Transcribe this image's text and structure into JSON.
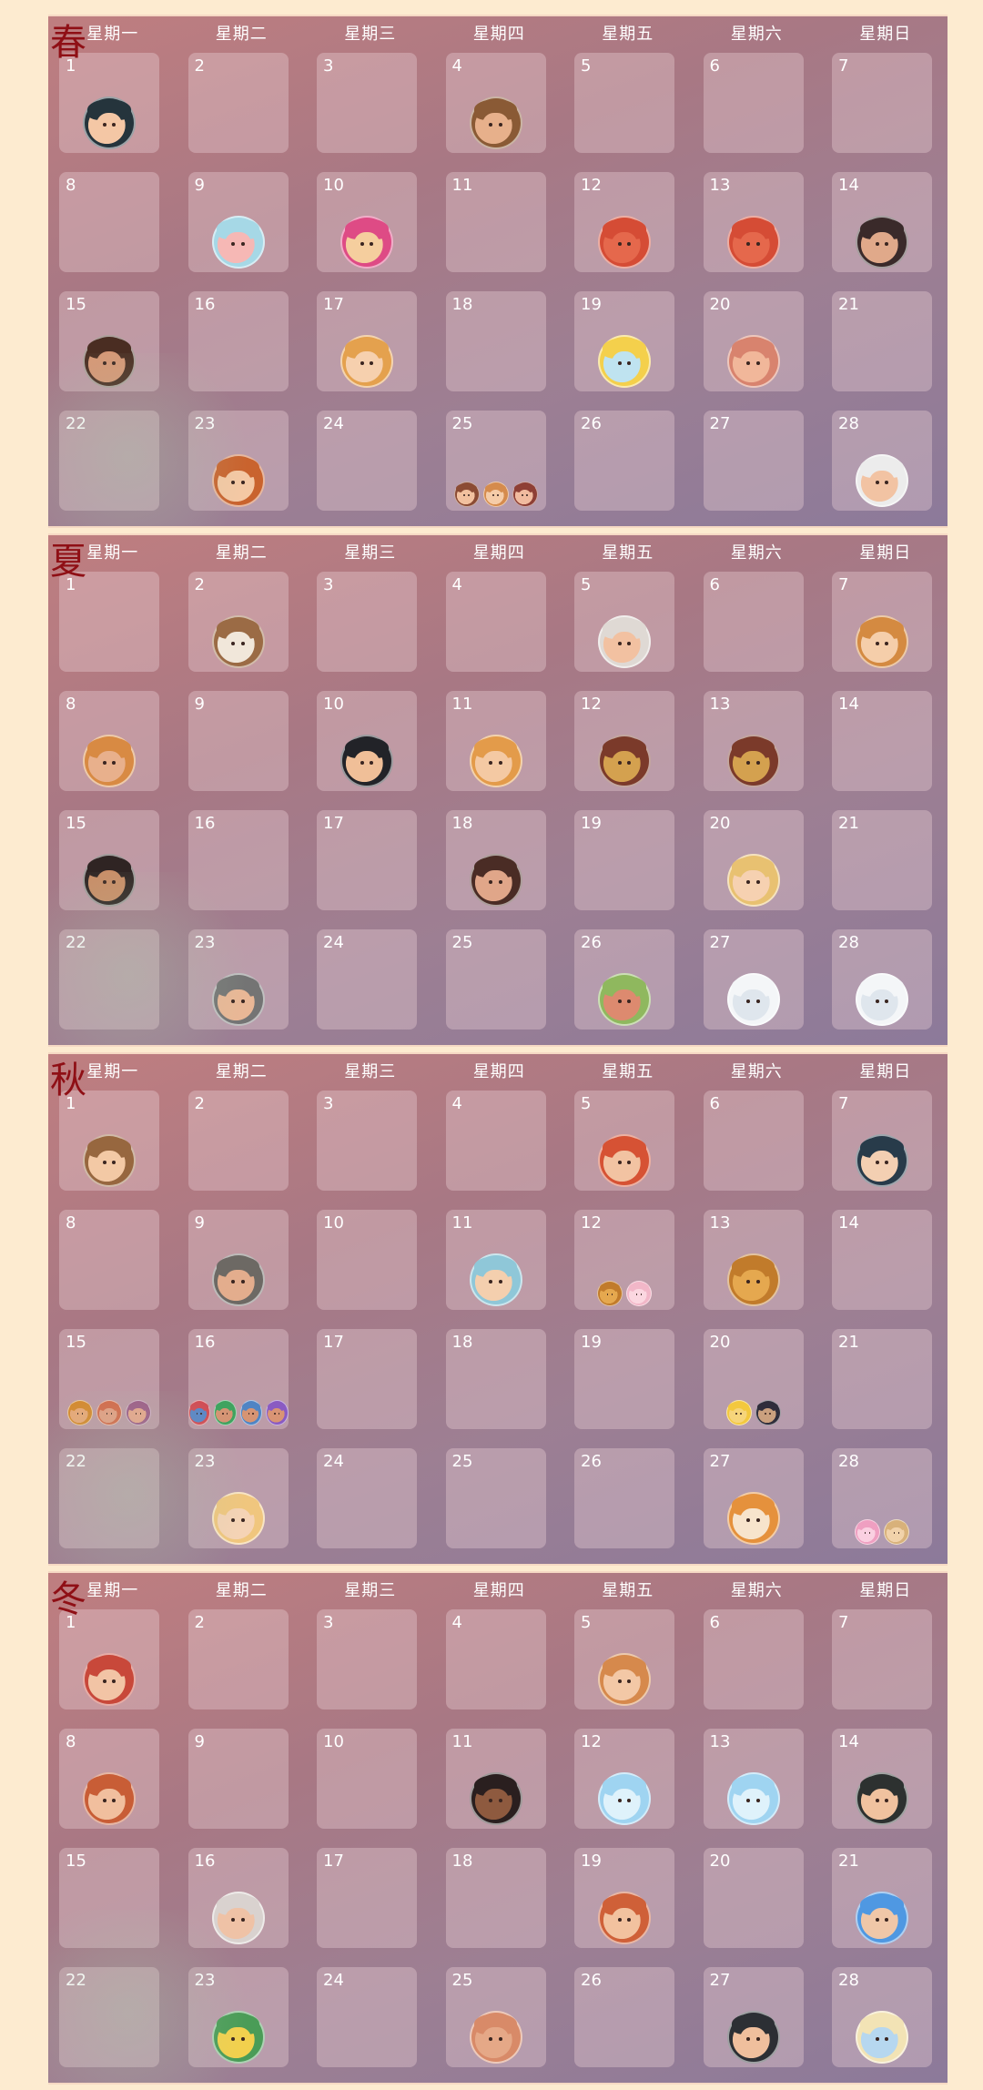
{
  "weekday_labels": [
    "星期一",
    "星期二",
    "星期三",
    "星期四",
    "星期五",
    "星期六",
    "星期日"
  ],
  "seasons": [
    {
      "id": "spring",
      "label": "春",
      "days": [
        {
          "day": "1",
          "icons": [
            {
              "name": "dark-hair-boy-portrait-icon",
              "hair": "#25343c",
              "skin": "#f4c7a5"
            }
          ]
        },
        {
          "day": "2",
          "icons": []
        },
        {
          "day": "3",
          "icons": []
        },
        {
          "day": "4",
          "icons": [
            {
              "name": "bearded-man-portrait-icon",
              "hair": "#8a5a35",
              "skin": "#e7b08b"
            }
          ]
        },
        {
          "day": "5",
          "icons": []
        },
        {
          "day": "6",
          "icons": []
        },
        {
          "day": "7",
          "icons": []
        },
        {
          "day": "8",
          "icons": []
        },
        {
          "day": "9",
          "icons": [
            {
              "name": "pig-head-icon",
              "hair": "#a6d8e6",
              "skin": "#f6b8b5"
            }
          ]
        },
        {
          "day": "10",
          "icons": [
            {
              "name": "pink-hair-boy-portrait-icon",
              "hair": "#de4b85",
              "skin": "#f5ce9e"
            }
          ]
        },
        {
          "day": "11",
          "icons": []
        },
        {
          "day": "12",
          "icons": [
            {
              "name": "red-fish-icon",
              "hair": "#d54c35",
              "skin": "#e5684c"
            }
          ]
        },
        {
          "day": "13",
          "icons": [
            {
              "name": "red-fish-icon",
              "hair": "#d54c35",
              "skin": "#e5684c"
            }
          ]
        },
        {
          "day": "14",
          "icons": [
            {
              "name": "old-man-glasses-portrait-icon",
              "hair": "#3a2a2a",
              "skin": "#e0a98a"
            }
          ]
        },
        {
          "day": "15",
          "icons": [
            {
              "name": "long-hair-bearded-man-portrait-icon",
              "hair": "#4a2d22",
              "skin": "#d69776"
            }
          ]
        },
        {
          "day": "16",
          "icons": []
        },
        {
          "day": "17",
          "icons": [
            {
              "name": "blonde-woman-portrait-icon",
              "hair": "#e4a14e",
              "skin": "#f6d0ae"
            }
          ]
        },
        {
          "day": "18",
          "icons": []
        },
        {
          "day": "19",
          "icons": [
            {
              "name": "airship-icon",
              "hair": "#f4d04c",
              "skin": "#bfe3f0"
            }
          ]
        },
        {
          "day": "20",
          "icons": [
            {
              "name": "bald-old-man-portrait-icon",
              "hair": "#d8836e",
              "skin": "#f1b79a"
            }
          ]
        },
        {
          "day": "21",
          "icons": []
        },
        {
          "day": "22",
          "icons": []
        },
        {
          "day": "23",
          "icons": [
            {
              "name": "curly-red-hair-woman-portrait-icon",
              "hair": "#c9632e",
              "skin": "#f4c8a4"
            }
          ]
        },
        {
          "day": "24",
          "icons": []
        },
        {
          "day": "25",
          "icons": [
            {
              "name": "small-boy-portrait-icon",
              "hair": "#8b4b34",
              "skin": "#f2c19f"
            },
            {
              "name": "small-girl-portrait-icon",
              "hair": "#d58b4d",
              "skin": "#f5cca8"
            },
            {
              "name": "small-child-portrait-icon",
              "hair": "#8e3f35",
              "skin": "#f1bb9f"
            }
          ]
        },
        {
          "day": "26",
          "icons": []
        },
        {
          "day": "27",
          "icons": []
        },
        {
          "day": "28",
          "icons": [
            {
              "name": "grandma-portrait-icon",
              "hair": "#ececec",
              "skin": "#f2c3a3"
            }
          ]
        }
      ]
    },
    {
      "id": "summer",
      "label": "夏",
      "days": [
        {
          "day": "1",
          "icons": []
        },
        {
          "day": "2",
          "icons": [
            {
              "name": "bear-portrait-icon",
              "hair": "#9b6b45",
              "skin": "#f1e7da"
            }
          ]
        },
        {
          "day": "3",
          "icons": []
        },
        {
          "day": "4",
          "icons": []
        },
        {
          "day": "5",
          "icons": [
            {
              "name": "grandma-bun-portrait-icon",
              "hair": "#dfd9d4",
              "skin": "#f2c1a1"
            }
          ]
        },
        {
          "day": "6",
          "icons": []
        },
        {
          "day": "7",
          "icons": [
            {
              "name": "ginger-girl-portrait-icon",
              "hair": "#d48a41",
              "skin": "#f5ceaa"
            }
          ]
        },
        {
          "day": "8",
          "icons": [
            {
              "name": "tribal-girl-portrait-icon",
              "hair": "#d88a43",
              "skin": "#e8b08c"
            }
          ]
        },
        {
          "day": "9",
          "icons": []
        },
        {
          "day": "10",
          "icons": [
            {
              "name": "dark-hair-man-portrait-icon",
              "hair": "#222328",
              "skin": "#f0bf98"
            }
          ]
        },
        {
          "day": "11",
          "icons": [
            {
              "name": "blonde-long-hair-man-portrait-icon",
              "hair": "#e39b4a",
              "skin": "#f4c9a3"
            }
          ]
        },
        {
          "day": "12",
          "icons": [
            {
              "name": "event-scroll-icon",
              "hair": "#7b3a2a",
              "skin": "#d4a14f"
            }
          ]
        },
        {
          "day": "13",
          "icons": [
            {
              "name": "event-scroll-icon",
              "hair": "#7b3a2a",
              "skin": "#d4a14f"
            }
          ]
        },
        {
          "day": "14",
          "icons": []
        },
        {
          "day": "15",
          "icons": [
            {
              "name": "feather-headband-girl-portrait-icon",
              "hair": "#2f2423",
              "skin": "#c98d67"
            }
          ]
        },
        {
          "day": "16",
          "icons": []
        },
        {
          "day": "17",
          "icons": []
        },
        {
          "day": "18",
          "icons": [
            {
              "name": "bearded-man-portrait-icon",
              "hair": "#4a2c25",
              "skin": "#e0a689"
            }
          ]
        },
        {
          "day": "19",
          "icons": []
        },
        {
          "day": "20",
          "icons": [
            {
              "name": "nurse-portrait-icon",
              "hair": "#e8c171",
              "skin": "#f6d1b1"
            }
          ]
        },
        {
          "day": "21",
          "icons": []
        },
        {
          "day": "22",
          "icons": []
        },
        {
          "day": "23",
          "icons": [
            {
              "name": "old-man-portrait-icon",
              "hair": "#747474",
              "skin": "#e9b796"
            }
          ]
        },
        {
          "day": "24",
          "icons": []
        },
        {
          "day": "25",
          "icons": []
        },
        {
          "day": "26",
          "icons": [
            {
              "name": "green-hair-man-portrait-icon",
              "hair": "#8fb85e",
              "skin": "#dd8a6f"
            }
          ]
        },
        {
          "day": "27",
          "icons": [
            {
              "name": "ghost-icon",
              "hair": "#f4f6f8",
              "skin": "#dfe6ed"
            }
          ]
        },
        {
          "day": "28",
          "icons": [
            {
              "name": "ghost-icon",
              "hair": "#f4f6f8",
              "skin": "#dfe6ed"
            }
          ]
        }
      ]
    },
    {
      "id": "autumn",
      "label": "秋",
      "days": [
        {
          "day": "1",
          "icons": [
            {
              "name": "glasses-woman-portrait-icon",
              "hair": "#97673f",
              "skin": "#f3c9a5"
            }
          ]
        },
        {
          "day": "2",
          "icons": []
        },
        {
          "day": "3",
          "icons": []
        },
        {
          "day": "4",
          "icons": []
        },
        {
          "day": "5",
          "icons": [
            {
              "name": "red-hair-boy-portrait-icon",
              "hair": "#d65234",
              "skin": "#f2c3a2"
            }
          ]
        },
        {
          "day": "6",
          "icons": []
        },
        {
          "day": "7",
          "icons": [
            {
              "name": "dark-bob-woman-portrait-icon",
              "hair": "#283b4a",
              "skin": "#f3cfb2"
            }
          ]
        },
        {
          "day": "8",
          "icons": []
        },
        {
          "day": "9",
          "icons": [
            {
              "name": "grey-bearded-man-portrait-icon",
              "hair": "#6d6964",
              "skin": "#e3ad8d"
            }
          ]
        },
        {
          "day": "10",
          "icons": []
        },
        {
          "day": "11",
          "icons": [
            {
              "name": "mushroom-girl-portrait-icon",
              "hair": "#8fc7d8",
              "skin": "#f4cfae"
            }
          ]
        },
        {
          "day": "12",
          "icons": [
            {
              "name": "crown-icon",
              "hair": "#c17b2b",
              "skin": "#e5a84f"
            },
            {
              "name": "pink-pig-icon",
              "hair": "#f2b7c8",
              "skin": "#fbd7e0"
            }
          ]
        },
        {
          "day": "13",
          "icons": [
            {
              "name": "crown-icon",
              "hair": "#c17b2b",
              "skin": "#e5a84f"
            }
          ]
        },
        {
          "day": "14",
          "icons": []
        },
        {
          "day": "15",
          "icons": [
            {
              "name": "goggles-boy-portrait-icon",
              "hair": "#d5892f",
              "skin": "#e8a878"
            },
            {
              "name": "goggles-boy-portrait-icon",
              "hair": "#d46a4b",
              "skin": "#e39f84"
            },
            {
              "name": "goggles-girl-portrait-icon",
              "hair": "#9e5e88",
              "skin": "#e7a68d"
            }
          ]
        },
        {
          "day": "16",
          "icons": [
            {
              "name": "goggles-boy-portrait-icon",
              "hair": "#d04e56",
              "skin": "#5c87c6"
            },
            {
              "name": "goggles-boy-portrait-icon",
              "hair": "#3fa35f",
              "skin": "#d59474"
            },
            {
              "name": "goggles-boy-portrait-icon",
              "hair": "#4f84c4",
              "skin": "#d69473"
            },
            {
              "name": "goggles-girl-portrait-icon",
              "hair": "#8a5bc2",
              "skin": "#d99474"
            }
          ]
        },
        {
          "day": "17",
          "icons": []
        },
        {
          "day": "18",
          "icons": []
        },
        {
          "day": "19",
          "icons": []
        },
        {
          "day": "20",
          "icons": [
            {
              "name": "chick-icon",
              "hair": "#f3c83e",
              "skin": "#f6d57b"
            },
            {
              "name": "bearded-man-portrait-icon",
              "hair": "#2f2d3b",
              "skin": "#caa07e"
            }
          ]
        },
        {
          "day": "21",
          "icons": []
        },
        {
          "day": "22",
          "icons": []
        },
        {
          "day": "23",
          "icons": [
            {
              "name": "aviator-girl-portrait-icon",
              "hair": "#f0c67e",
              "skin": "#f5d3b5"
            }
          ]
        },
        {
          "day": "24",
          "icons": []
        },
        {
          "day": "25",
          "icons": []
        },
        {
          "day": "26",
          "icons": []
        },
        {
          "day": "27",
          "icons": [
            {
              "name": "fox-dog-icon",
              "hair": "#e5913c",
              "skin": "#f7e4cc"
            }
          ]
        },
        {
          "day": "28",
          "icons": [
            {
              "name": "pink-creature-icon",
              "hair": "#ef9fc1",
              "skin": "#fad0e1"
            },
            {
              "name": "wooden-doll-icon",
              "hair": "#d8b17a",
              "skin": "#f1d2aa"
            }
          ]
        }
      ]
    },
    {
      "id": "winter",
      "label": "冬",
      "days": [
        {
          "day": "1",
          "icons": [
            {
              "name": "red-hair-woman-portrait-icon",
              "hair": "#c8483a",
              "skin": "#f2c4a5"
            }
          ]
        },
        {
          "day": "2",
          "icons": []
        },
        {
          "day": "3",
          "icons": []
        },
        {
          "day": "4",
          "icons": []
        },
        {
          "day": "5",
          "icons": [
            {
              "name": "cap-boy-portrait-icon",
              "hair": "#d6894c",
              "skin": "#f3c8a6"
            }
          ]
        },
        {
          "day": "6",
          "icons": []
        },
        {
          "day": "7",
          "icons": []
        },
        {
          "day": "8",
          "icons": [
            {
              "name": "ginger-man-portrait-icon",
              "hair": "#c85d36",
              "skin": "#f1bf9e"
            }
          ]
        },
        {
          "day": "9",
          "icons": []
        },
        {
          "day": "10",
          "icons": []
        },
        {
          "day": "11",
          "icons": [
            {
              "name": "braided-woman-portrait-icon",
              "hair": "#2a1f1f",
              "skin": "#8e5a3f"
            }
          ]
        },
        {
          "day": "12",
          "icons": [
            {
              "name": "blue-fish-bubble-icon",
              "hair": "#9fd4f1",
              "skin": "#dff2fb"
            }
          ]
        },
        {
          "day": "13",
          "icons": [
            {
              "name": "blue-fish-bubble-icon",
              "hair": "#9fd4f1",
              "skin": "#dff2fb"
            }
          ]
        },
        {
          "day": "14",
          "icons": [
            {
              "name": "dark-hair-man-portrait-icon",
              "hair": "#2d3130",
              "skin": "#f0c29f"
            }
          ]
        },
        {
          "day": "15",
          "icons": []
        },
        {
          "day": "16",
          "icons": [
            {
              "name": "bald-old-man-portrait-icon",
              "hair": "#d9d2cf",
              "skin": "#efc2a6"
            }
          ]
        },
        {
          "day": "17",
          "icons": []
        },
        {
          "day": "18",
          "icons": []
        },
        {
          "day": "19",
          "icons": [
            {
              "name": "cap-boy-portrait-icon",
              "hair": "#cf6038",
              "skin": "#f2c29f"
            }
          ]
        },
        {
          "day": "20",
          "icons": []
        },
        {
          "day": "21",
          "icons": [
            {
              "name": "blue-hair-goggles-portrait-icon",
              "hair": "#4f98e2",
              "skin": "#f0c7a8"
            }
          ]
        },
        {
          "day": "22",
          "icons": []
        },
        {
          "day": "23",
          "icons": [
            {
              "name": "winter-wreath-icon",
              "hair": "#4a9c57",
              "skin": "#f2d04d"
            }
          ]
        },
        {
          "day": "24",
          "icons": []
        },
        {
          "day": "25",
          "icons": [
            {
              "name": "bald-bearded-man-portrait-icon",
              "hair": "#d88a68",
              "skin": "#e5a887"
            }
          ]
        },
        {
          "day": "26",
          "icons": []
        },
        {
          "day": "27",
          "icons": [
            {
              "name": "dark-hair-man-portrait-icon",
              "hair": "#2c2f34",
              "skin": "#efbf9d"
            }
          ]
        },
        {
          "day": "28",
          "icons": [
            {
              "name": "cake-icon",
              "hair": "#f2e3b5",
              "skin": "#b6d7ef"
            }
          ]
        }
      ]
    }
  ]
}
